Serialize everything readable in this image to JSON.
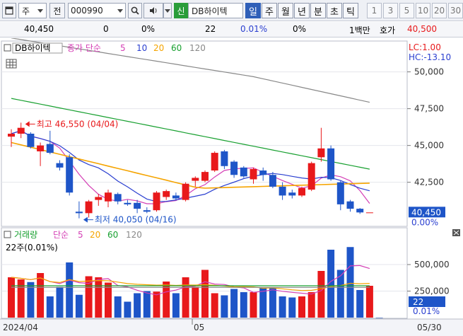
{
  "toolbar": {
    "market_label": "주",
    "jeon_label": "전",
    "code_value": "000990",
    "credit_badge": "신",
    "stock_name": "DB하이텍",
    "periods": [
      "일",
      "주",
      "월",
      "년",
      "분",
      "초",
      "틱"
    ],
    "active_period": "일",
    "intervals": [
      "1",
      "3",
      "5",
      "10",
      "20",
      "30"
    ]
  },
  "quote": {
    "price": "40,450",
    "change": "0",
    "change_pct": "0%",
    "volume": "22",
    "volume_pct": "0.01%",
    "vol_change_pct": "0%",
    "unit": "1백만",
    "ask_label": "호가",
    "ask_price": "40,500"
  },
  "price_pane": {
    "stock_label": "DB하이텍",
    "ma_title": "종가 단순",
    "ma_periods": [
      "5",
      "10",
      "20",
      "60",
      "120"
    ],
    "ma_colors": [
      "#d43fb5",
      "#2a3fd0",
      "#f5a400",
      "#18a030",
      "#888888"
    ],
    "lc_label": "LC:1.00",
    "hc_label": "HC:-13.10",
    "high_annotation": "최고 46,550 (04/04)",
    "low_annotation": "최저 40,050 (04/16)",
    "current_price_tag": "40,450",
    "current_pct_tag": "0.00%"
  },
  "volume_pane": {
    "title": "거래량",
    "ma_title": "단순",
    "ma_periods": [
      "5",
      "20",
      "60",
      "120"
    ],
    "ma_colors": [
      "#d43fb5",
      "#f5a400",
      "#18a030",
      "#888888"
    ],
    "current_label": "22주(0.01%)",
    "current_tag": "22",
    "current_pct_tag": "0.01%"
  },
  "x_axis": {
    "labels": [
      "2024/04",
      "05",
      "05/30"
    ]
  },
  "colors": {
    "up": "#e8191b",
    "down": "#1e55c8",
    "tag_bg": "#1e55c8"
  },
  "chart_data": [
    {
      "type": "candlestick",
      "y_axis_ticks": [
        50000,
        47500,
        45000,
        42500
      ],
      "ylim": [
        39600,
        52000
      ],
      "candles": [
        {
          "o": 45600,
          "h": 46100,
          "l": 44900,
          "c": 45800
        },
        {
          "o": 45800,
          "h": 46550,
          "l": 45500,
          "c": 46200
        },
        {
          "o": 45800,
          "h": 45900,
          "l": 44800,
          "c": 44900
        },
        {
          "o": 44600,
          "h": 45200,
          "l": 43600,
          "c": 45000
        },
        {
          "o": 45100,
          "h": 46000,
          "l": 44400,
          "c": 44500
        },
        {
          "o": 43800,
          "h": 44000,
          "l": 43300,
          "c": 43500
        },
        {
          "o": 44200,
          "h": 44400,
          "l": 41600,
          "c": 41800
        },
        {
          "o": 40500,
          "h": 41200,
          "l": 40050,
          "c": 40400
        },
        {
          "o": 40400,
          "h": 41300,
          "l": 40100,
          "c": 41200
        },
        {
          "o": 41300,
          "h": 41700,
          "l": 40900,
          "c": 41500
        },
        {
          "o": 41200,
          "h": 42000,
          "l": 40800,
          "c": 41800
        },
        {
          "o": 41700,
          "h": 41800,
          "l": 41000,
          "c": 41200
        },
        {
          "o": 41100,
          "h": 41300,
          "l": 40900,
          "c": 41000
        },
        {
          "o": 41100,
          "h": 41300,
          "l": 40400,
          "c": 40700
        },
        {
          "o": 40600,
          "h": 40800,
          "l": 40400,
          "c": 40500
        },
        {
          "o": 40600,
          "h": 41900,
          "l": 40500,
          "c": 41800
        },
        {
          "o": 41500,
          "h": 42000,
          "l": 41300,
          "c": 41900
        },
        {
          "o": 41600,
          "h": 41800,
          "l": 41300,
          "c": 41400
        },
        {
          "o": 41300,
          "h": 42500,
          "l": 41200,
          "c": 42400
        },
        {
          "o": 42600,
          "h": 42900,
          "l": 42200,
          "c": 42800
        },
        {
          "o": 42600,
          "h": 43300,
          "l": 42500,
          "c": 43200
        },
        {
          "o": 43300,
          "h": 44600,
          "l": 43200,
          "c": 44500
        },
        {
          "o": 44600,
          "h": 44700,
          "l": 43400,
          "c": 43600
        },
        {
          "o": 43900,
          "h": 44000,
          "l": 42800,
          "c": 43000
        },
        {
          "o": 43500,
          "h": 43600,
          "l": 42800,
          "c": 42900
        },
        {
          "o": 42700,
          "h": 43500,
          "l": 42400,
          "c": 43400
        },
        {
          "o": 43300,
          "h": 43500,
          "l": 42600,
          "c": 43000
        },
        {
          "o": 43000,
          "h": 43200,
          "l": 42100,
          "c": 42200
        },
        {
          "o": 42200,
          "h": 42500,
          "l": 41300,
          "c": 41600
        },
        {
          "o": 41800,
          "h": 42000,
          "l": 41400,
          "c": 41600
        },
        {
          "o": 41600,
          "h": 42200,
          "l": 41500,
          "c": 42100
        },
        {
          "o": 42000,
          "h": 43900,
          "l": 41900,
          "c": 43800
        },
        {
          "o": 44200,
          "h": 46200,
          "l": 43900,
          "c": 44800
        },
        {
          "o": 44800,
          "h": 45000,
          "l": 42600,
          "c": 42700
        },
        {
          "o": 42500,
          "h": 42600,
          "l": 40600,
          "c": 41000
        },
        {
          "o": 41200,
          "h": 41300,
          "l": 40500,
          "c": 40700
        },
        {
          "o": 40700,
          "h": 40750,
          "l": 40350,
          "c": 40450
        },
        {
          "o": 40450,
          "h": 40450,
          "l": 40450,
          "c": 40450
        }
      ]
    },
    {
      "type": "bar",
      "y_axis_ticks": [
        500000,
        250000
      ],
      "ylim": [
        0,
        700000
      ],
      "values": [
        380000,
        360000,
        335000,
        420000,
        200000,
        290000,
        520000,
        215000,
        390000,
        380000,
        330000,
        200000,
        150000,
        230000,
        250000,
        245000,
        340000,
        230000,
        380000,
        290000,
        450000,
        230000,
        210000,
        270000,
        240000,
        240000,
        280000,
        280000,
        200000,
        190000,
        200000,
        240000,
        440000,
        640000,
        450000,
        665000,
        260000,
        300000,
        22
      ]
    }
  ]
}
